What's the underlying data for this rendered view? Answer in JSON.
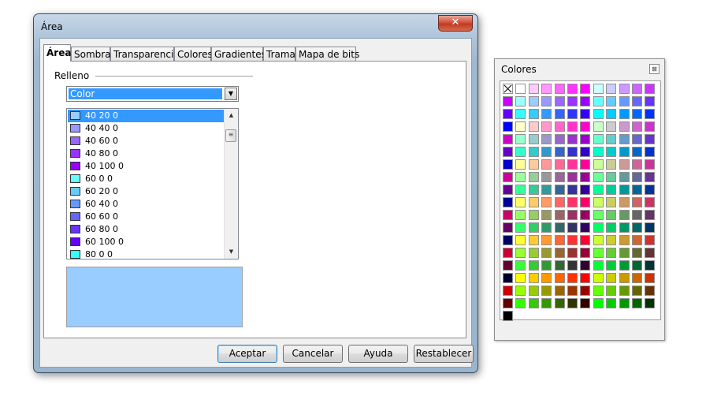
{
  "dialog": {
    "title": "Área",
    "close_glyph": "✕",
    "tabs": [
      "Área",
      "Sombra",
      "Transparencia",
      "Colores",
      "Gradientes",
      "Trama",
      "Mapa de bits"
    ],
    "active_tab": "Área",
    "fill_group_label": "Relleno",
    "fill_type": "Color",
    "color_list": [
      {
        "label": "40 20 0",
        "color": "#99ccff"
      },
      {
        "label": "40 40 0",
        "color": "#9999ff"
      },
      {
        "label": "40 60 0",
        "color": "#9966ff"
      },
      {
        "label": "40 80 0",
        "color": "#9933ff"
      },
      {
        "label": "40 100 0",
        "color": "#9900ff"
      },
      {
        "label": "60 0 0",
        "color": "#66ffff"
      },
      {
        "label": "60 20 0",
        "color": "#66ccff"
      },
      {
        "label": "60 40 0",
        "color": "#6699ff"
      },
      {
        "label": "60 60 0",
        "color": "#6666ff"
      },
      {
        "label": "60 80 0",
        "color": "#6633ff"
      },
      {
        "label": "60 100 0",
        "color": "#6600ff"
      },
      {
        "label": "80 0 0",
        "color": "#33ffff"
      }
    ],
    "selected_color": "40 20 0",
    "preview_color": "#99ccff",
    "buttons": {
      "ok": "Aceptar",
      "cancel": "Cancelar",
      "help": "Ayuda",
      "reset": "Restablecer"
    }
  },
  "palette": {
    "title": "Colores",
    "close_glyph": "⊠",
    "rows": [
      [
        "none",
        "#ffffff",
        "#ffccff",
        "#ff99ff",
        "#ff66ff",
        "#ff33ff",
        "#ff00ff",
        "#ccffff",
        "#ccccff",
        "#cc99ff",
        "#cc66ff",
        "#cc33ff"
      ],
      [
        "#cc00ff",
        "#99ffff",
        "#99ccff",
        "#9999ff",
        "#9966ff",
        "#9933ff",
        "#9900ff",
        "#66ffff",
        "#66ccff",
        "#6699ff",
        "#6666ff",
        "#6633ff"
      ],
      [
        "#6600ff",
        "#33ffff",
        "#33ccff",
        "#3399ff",
        "#3366ff",
        "#3333ff",
        "#3300ff",
        "#00ffff",
        "#00ccff",
        "#0099ff",
        "#0066ff",
        "#0033ff"
      ],
      [
        "#0000ff",
        "#ffffcc",
        "#ffcccc",
        "#ff99cc",
        "#ff66cc",
        "#ff33cc",
        "#ff00cc",
        "#ccffcc",
        "#cccccc",
        "#cc99cc",
        "#cc66cc",
        "#cc33cc"
      ],
      [
        "#cc00cc",
        "#99ffcc",
        "#99cccc",
        "#9999cc",
        "#9966cc",
        "#9933cc",
        "#9900cc",
        "#66ffcc",
        "#66cccc",
        "#6699cc",
        "#6666cc",
        "#6633cc"
      ],
      [
        "#6600cc",
        "#33ffcc",
        "#33cccc",
        "#3399cc",
        "#3366cc",
        "#3333cc",
        "#3300cc",
        "#00ffcc",
        "#00cccc",
        "#0099cc",
        "#0066cc",
        "#0033cc"
      ],
      [
        "#0000cc",
        "#ffff99",
        "#ffcc99",
        "#ff9999",
        "#ff6699",
        "#ff3399",
        "#ff0099",
        "#ccff99",
        "#cccc99",
        "#cc9999",
        "#cc6699",
        "#cc3399"
      ],
      [
        "#cc0099",
        "#99ff99",
        "#99cc99",
        "#999999",
        "#996699",
        "#993399",
        "#990099",
        "#66ff99",
        "#66cc99",
        "#669999",
        "#666699",
        "#663399"
      ],
      [
        "#660099",
        "#33ff99",
        "#33cc99",
        "#339999",
        "#336699",
        "#333399",
        "#330099",
        "#00ff99",
        "#00cc99",
        "#009999",
        "#006699",
        "#003399"
      ],
      [
        "#000099",
        "#ffff66",
        "#ffcc66",
        "#ff9966",
        "#ff6666",
        "#ff3366",
        "#ff0066",
        "#ccff66",
        "#cccc66",
        "#cc9966",
        "#cc6666",
        "#cc3366"
      ],
      [
        "#cc0066",
        "#99ff66",
        "#99cc66",
        "#999966",
        "#996666",
        "#993366",
        "#990066",
        "#66ff66",
        "#66cc66",
        "#669966",
        "#666666",
        "#663366"
      ],
      [
        "#660066",
        "#33ff66",
        "#33cc66",
        "#339966",
        "#336666",
        "#333366",
        "#330066",
        "#00ff66",
        "#00cc66",
        "#009966",
        "#006666",
        "#003366"
      ],
      [
        "#000066",
        "#ffff33",
        "#ffcc33",
        "#ff9933",
        "#ff6633",
        "#ff3333",
        "#ff0033",
        "#ccff33",
        "#cccc33",
        "#cc9933",
        "#cc6633",
        "#cc3333"
      ],
      [
        "#cc0033",
        "#99ff33",
        "#99cc33",
        "#999933",
        "#996633",
        "#993333",
        "#990033",
        "#66ff33",
        "#66cc33",
        "#669933",
        "#666633",
        "#663333"
      ],
      [
        "#660033",
        "#33ff33",
        "#33cc33",
        "#339933",
        "#336633",
        "#333333",
        "#330033",
        "#00ff33",
        "#00cc33",
        "#009933",
        "#006633",
        "#003333"
      ],
      [
        "#000033",
        "#ffff00",
        "#ffcc00",
        "#ff9900",
        "#ff6600",
        "#ff3300",
        "#ff0000",
        "#ccff00",
        "#cccc00",
        "#cc9900",
        "#cc6600",
        "#cc3300"
      ],
      [
        "#cc0000",
        "#99ff00",
        "#99cc00",
        "#999900",
        "#996600",
        "#993300",
        "#990000",
        "#66ff00",
        "#66cc00",
        "#669900",
        "#666600",
        "#663300"
      ],
      [
        "#660000",
        "#33ff00",
        "#33cc00",
        "#339900",
        "#336600",
        "#333300",
        "#330000",
        "#00ff00",
        "#00cc00",
        "#009900",
        "#006600",
        "#003300"
      ],
      [
        "#000000"
      ]
    ]
  }
}
